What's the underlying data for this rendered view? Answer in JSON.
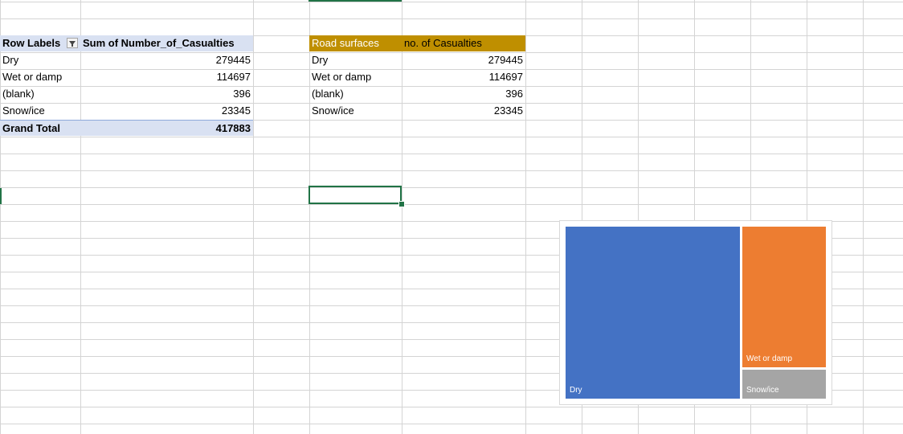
{
  "pivot": {
    "header_row_labels": "Row Labels",
    "header_sum": "Sum of Number_of_Casualties",
    "filter_icon": "filter-dropdown-icon",
    "rows": [
      {
        "label": "Dry",
        "value": "279445"
      },
      {
        "label": "Wet or damp",
        "value": "114697"
      },
      {
        "label": "(blank)",
        "value": "396"
      },
      {
        "label": "Snow/ice",
        "value": "23345"
      }
    ],
    "total_label": "Grand Total",
    "total_value": "417883"
  },
  "table": {
    "header_col1": "Road surfaces",
    "header_col2": "no. of Casualties",
    "rows": [
      {
        "label": "Dry",
        "value": "279445"
      },
      {
        "label": "Wet or damp",
        "value": "114697"
      },
      {
        "label": "(blank)",
        "value": "396"
      },
      {
        "label": "Snow/ice",
        "value": "23345"
      }
    ]
  },
  "colors": {
    "pivot_header": "#d9e1f2",
    "table_header": "#bf8f00",
    "table_header_text": "#ffffff",
    "selection": "#217346",
    "gridline": "#d4d4d4"
  },
  "chart_data": {
    "type": "treemap",
    "categories": [
      "Dry",
      "Wet or damp",
      "Snow/ice"
    ],
    "values": [
      279445,
      114697,
      23345
    ],
    "colors": [
      "#4472c4",
      "#ed7d31",
      "#a5a5a5"
    ],
    "title": ""
  }
}
